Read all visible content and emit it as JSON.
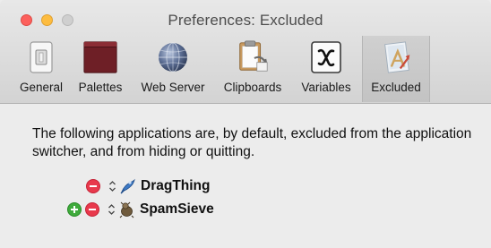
{
  "window": {
    "title": "Preferences: Excluded"
  },
  "toolbar": {
    "items": [
      {
        "label": "General",
        "icon": "general-switch-icon"
      },
      {
        "label": "Palettes",
        "icon": "palettes-icon"
      },
      {
        "label": "Web Server",
        "icon": "globe-icon"
      },
      {
        "label": "Clipboards",
        "icon": "clipboard-icon"
      },
      {
        "label": "Variables",
        "icon": "variable-x-icon"
      },
      {
        "label": "Excluded",
        "icon": "excluded-app-icon"
      }
    ],
    "selected": "Excluded"
  },
  "content": {
    "description": "The following applications are, by default, excluded from the application switcher, and from hiding or quitting.",
    "apps": [
      {
        "name": "DragThing",
        "icon": "dragthing-app-icon"
      },
      {
        "name": "SpamSieve",
        "icon": "spamsieve-app-icon"
      }
    ]
  },
  "colors": {
    "close": "#fc605c",
    "minimize": "#fdbc40",
    "remove": "#e8394c",
    "add": "#3faa3c"
  }
}
